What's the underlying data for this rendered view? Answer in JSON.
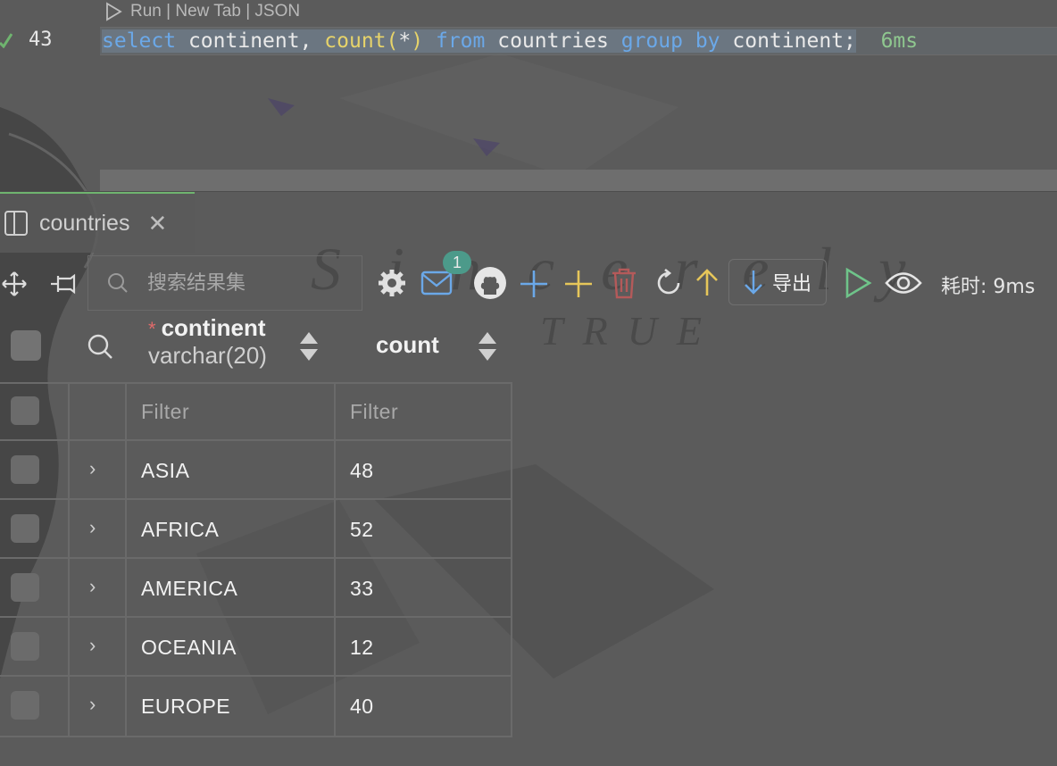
{
  "editor": {
    "codelens": "Run | New Tab | JSON",
    "line_number": "43",
    "code": {
      "kw_select": "select",
      "col1": "continent,",
      "fn_count": "count",
      "paren_open": "(",
      "star": "*",
      "paren_close": ")",
      "kw_from": "from",
      "table": "countries",
      "kw_group": "group",
      "kw_by": "by",
      "col2": "continent;"
    },
    "duration": "6ms"
  },
  "tab": {
    "label": "countries"
  },
  "toolbar": {
    "search_placeholder": "搜索结果集",
    "mail_badge": "1",
    "export_label": "导出",
    "elapsed": "耗时: 9ms"
  },
  "columns": [
    {
      "name": "continent",
      "type": "varchar(20)",
      "required": "*"
    },
    {
      "name": "count"
    }
  ],
  "filter_placeholder": "Filter",
  "rows": [
    {
      "continent": "ASIA",
      "count": "48"
    },
    {
      "continent": "AFRICA",
      "count": "52"
    },
    {
      "continent": "AMERICA",
      "count": "33"
    },
    {
      "continent": "OCEANIA",
      "count": "12"
    },
    {
      "continent": "EUROPE",
      "count": "40"
    }
  ],
  "colors": {
    "accent_green": "#6fb46f",
    "keyword_blue": "#6ba8e8",
    "function_yellow": "#e6d36a",
    "duration_green": "#8fc78f"
  }
}
